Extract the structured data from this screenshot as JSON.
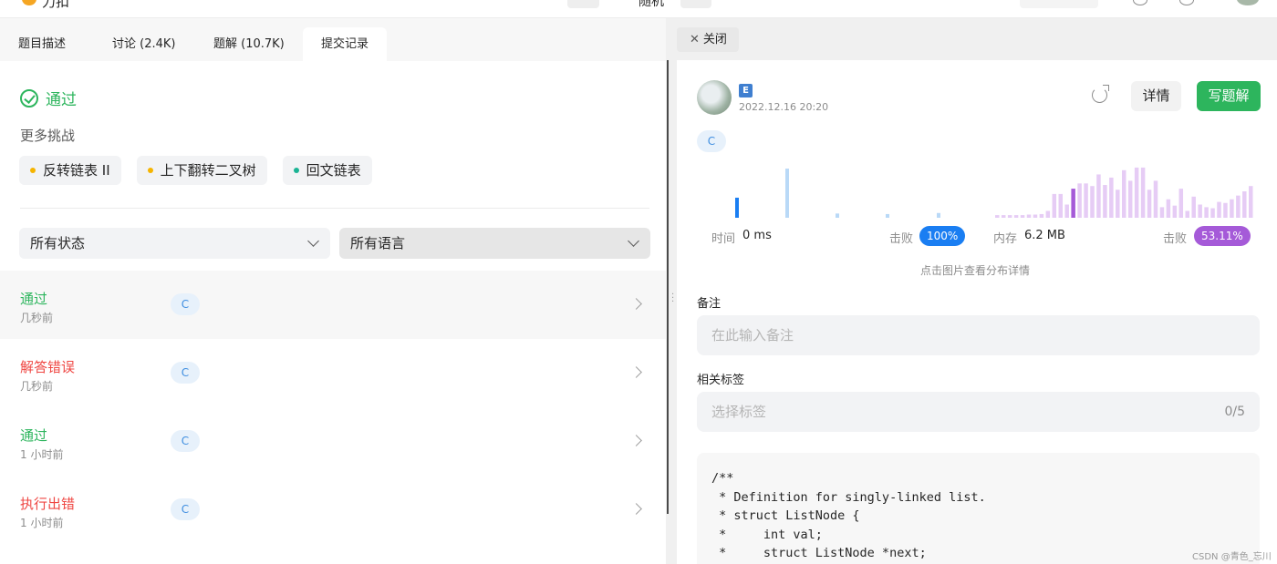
{
  "topbar": {
    "brand": "力扣",
    "mid_text": "随机"
  },
  "tabs": [
    {
      "label": "题目描述"
    },
    {
      "label": "讨论 (2.4K)"
    },
    {
      "label": "题解 (10.7K)"
    },
    {
      "label": "提交记录"
    }
  ],
  "result": {
    "status": "通过",
    "more_label": "更多挑战"
  },
  "challenges": [
    {
      "label": "反转链表 II",
      "dot_color": "#f5b400"
    },
    {
      "label": "上下翻转二叉树",
      "dot_color": "#f5b400"
    },
    {
      "label": "回文链表",
      "dot_color": "#1ab394"
    }
  ],
  "filters": {
    "status": "所有状态",
    "language": "所有语言"
  },
  "submissions": [
    {
      "status": "通过",
      "time": "几秒前",
      "lang": "C",
      "color": "#2db55d"
    },
    {
      "status": "解答错误",
      "time": "几秒前",
      "lang": "C",
      "color": "#ef4743"
    },
    {
      "status": "通过",
      "time": "1 小时前",
      "lang": "C",
      "color": "#2db55d"
    },
    {
      "status": "执行出错",
      "time": "1 小时前",
      "lang": "C",
      "color": "#ef4743"
    }
  ],
  "detail": {
    "close_label": "关闭",
    "badge": "E",
    "date": "2022.12.16 20:20",
    "detail_btn": "详情",
    "write_btn": "写题解",
    "lang": "C",
    "runtime_label": "时间",
    "runtime_value": "0 ms",
    "beat_label": "击败",
    "runtime_beat": "100%",
    "memory_label": "内存",
    "memory_value": "6.2 MB",
    "memory_beat": "53.11%",
    "chart_hint": "点击图片查看分布详情",
    "note_label": "备注",
    "note_placeholder": "在此输入备注",
    "tag_label": "相关标签",
    "tag_placeholder": "选择标签",
    "tag_count": "0/5",
    "code": "/**\n * Definition for singly-linked list.\n * struct ListNode {\n *     int val;\n *     struct ListNode *next;"
  },
  "watermark": "CSDN @青色_忘川",
  "colors": {
    "accent_green": "#2db55d",
    "error_red": "#ef4743",
    "runtime_blue": "#1a7ef2",
    "memory_purple": "#a55ad8"
  },
  "chart_data": [
    {
      "type": "bar",
      "series": [
        {
          "values": [
            0.38,
            0.93,
            0.08,
            0.07,
            0.09
          ]
        }
      ],
      "highlight_index": 0,
      "color": "#1a7ef2"
    },
    {
      "type": "bar",
      "series": [
        {
          "values": [
            0.05,
            0.05,
            0.05,
            0.05,
            0.05,
            0.06,
            0.06,
            0.07,
            0.13,
            0.45,
            0.45,
            0.25,
            0.55,
            0.65,
            0.65,
            0.6,
            0.82,
            0.62,
            0.76,
            0.53,
            0.9,
            0.7,
            0.95,
            0.95,
            0.53,
            0.7,
            0.2,
            0.35,
            0.23,
            0.55,
            0.13,
            0.4,
            0.25,
            0.2,
            0.18,
            0.3,
            0.28,
            0.35,
            0.42,
            0.5,
            0.6
          ]
        }
      ],
      "highlight_index": 12,
      "color": "#a55ad8"
    }
  ]
}
